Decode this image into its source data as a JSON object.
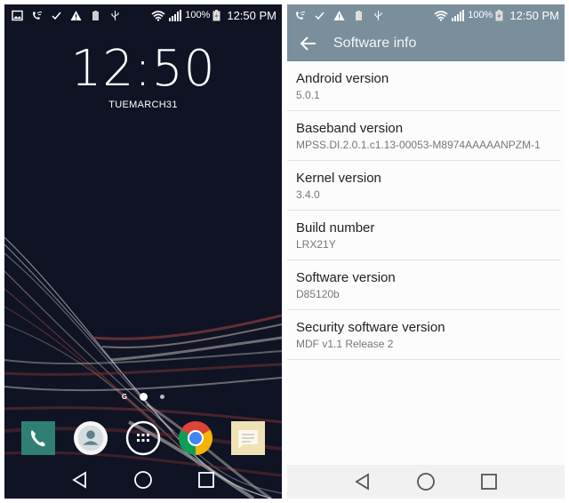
{
  "left": {
    "status_bar": {
      "left_icons": [
        "gallery-icon",
        "wifi-calling-icon",
        "check-icon",
        "warning-icon",
        "battery-saver-icon",
        "usb-icon"
      ],
      "right_icons": [
        "wifi-icon",
        "signal-icon"
      ],
      "battery_percent": "100%",
      "time": "12:50 PM"
    },
    "clock": "12:50",
    "date": "TUEMARCH31",
    "pager": {
      "home_label": "G",
      "pages": 2,
      "current_page": 1
    },
    "dock": [
      {
        "name": "Phone",
        "icon": "phone-icon"
      },
      {
        "name": "Contacts",
        "icon": "contacts-icon"
      },
      {
        "name": "Apps",
        "icon": "app-drawer-icon"
      },
      {
        "name": "Chrome",
        "icon": "chrome-icon"
      },
      {
        "name": "Messaging",
        "icon": "messaging-icon"
      }
    ],
    "nav": [
      "back",
      "home",
      "recents"
    ]
  },
  "right": {
    "status_bar": {
      "left_icons": [
        "wifi-calling-icon",
        "check-icon",
        "warning-icon",
        "battery-saver-icon",
        "usb-icon"
      ],
      "right_icons": [
        "wifi-icon",
        "signal-icon"
      ],
      "battery_percent": "100%",
      "time": "12:50 PM"
    },
    "colors": {
      "app_bar": "#7a8f9b"
    },
    "title": "Software info",
    "items": [
      {
        "title": "Android version",
        "value": "5.0.1"
      },
      {
        "title": "Baseband version",
        "value": "MPSS.DI.2.0.1.c1.13-00053-M8974AAAAANPZM-1"
      },
      {
        "title": "Kernel version",
        "value": "3.4.0"
      },
      {
        "title": "Build number",
        "value": "LRX21Y"
      },
      {
        "title": "Software version",
        "value": "D85120b"
      },
      {
        "title": "Security software version",
        "value": "MDF v1.1 Release 2"
      }
    ],
    "nav": [
      "back",
      "home",
      "recents"
    ]
  }
}
